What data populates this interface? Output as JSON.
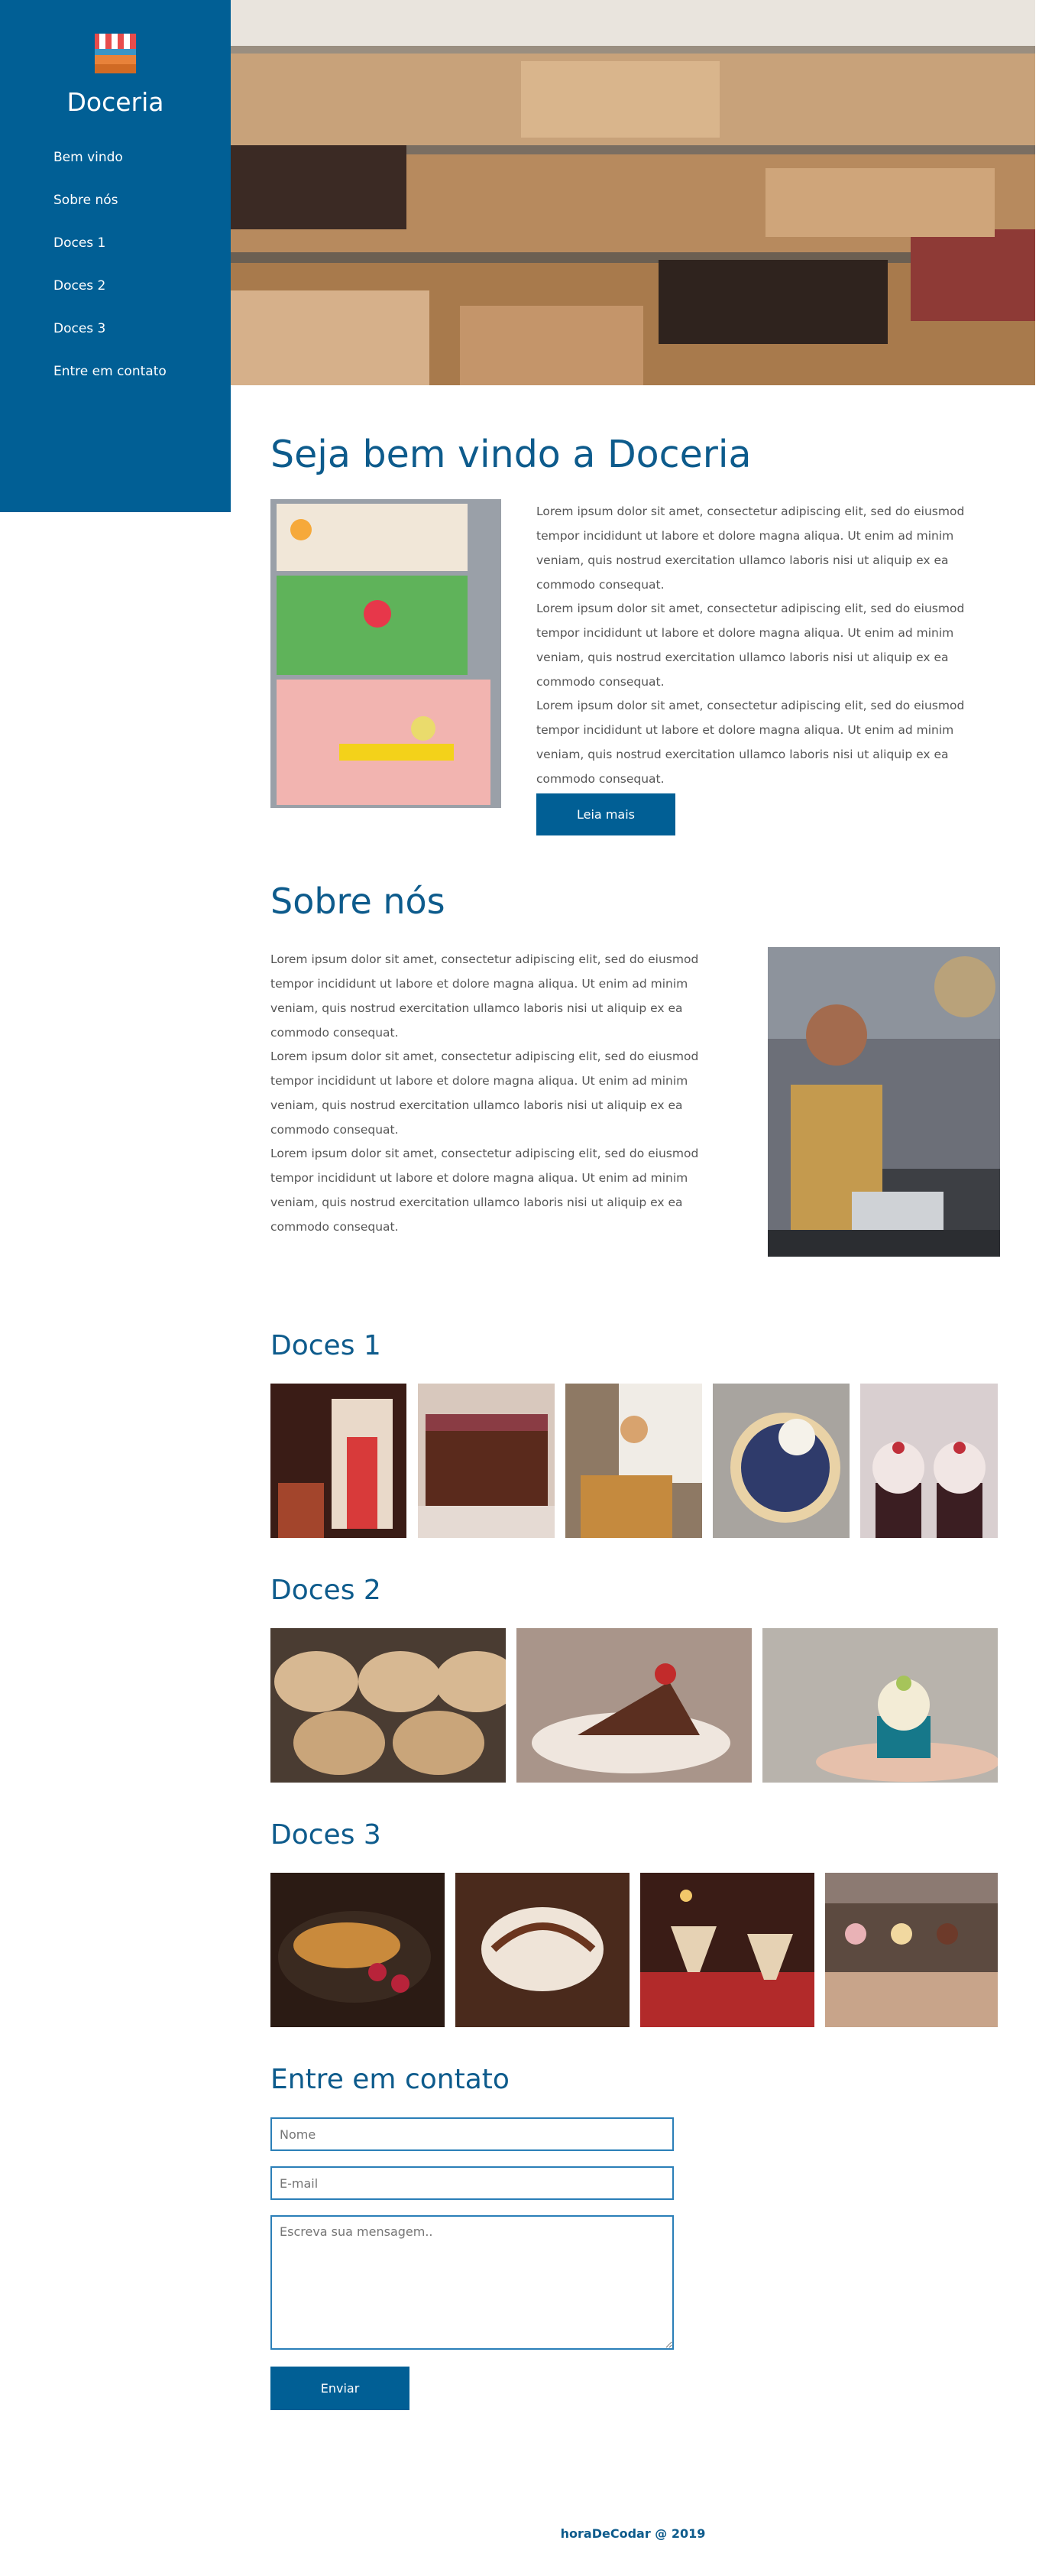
{
  "sidebar": {
    "brand": "Doceria",
    "items": [
      {
        "label": "Bem vindo"
      },
      {
        "label": "Sobre nós"
      },
      {
        "label": "Doces 1"
      },
      {
        "label": "Doces 2"
      },
      {
        "label": "Doces 3"
      },
      {
        "label": "Entre em contato"
      }
    ]
  },
  "welcome": {
    "title": "Seja bem vindo a Doceria",
    "paragraphs": [
      "Lorem ipsum dolor sit amet, consectetur adipiscing elit, sed do eiusmod tempor incididunt ut labore et dolore magna aliqua. Ut enim ad minim veniam, quis nostrud exercitation ullamco laboris nisi ut aliquip ex ea commodo consequat.",
      "Lorem ipsum dolor sit amet, consectetur adipiscing elit, sed do eiusmod tempor incididunt ut labore et dolore magna aliqua. Ut enim ad minim veniam, quis nostrud exercitation ullamco laboris nisi ut aliquip ex ea commodo consequat.",
      "Lorem ipsum dolor sit amet, consectetur adipiscing elit, sed do eiusmod tempor incididunt ut labore et dolore magna aliqua. Ut enim ad minim veniam, quis nostrud exercitation ullamco laboris nisi ut aliquip ex ea commodo consequat."
    ],
    "button": "Leia mais"
  },
  "about": {
    "title": "Sobre nós",
    "paragraphs": [
      "Lorem ipsum dolor sit amet, consectetur adipiscing elit, sed do eiusmod tempor incididunt ut labore et dolore magna aliqua. Ut enim ad minim veniam, quis nostrud exercitation ullamco laboris nisi ut aliquip ex ea commodo consequat.",
      "Lorem ipsum dolor sit amet, consectetur adipiscing elit, sed do eiusmod tempor incididunt ut labore et dolore magna aliqua. Ut enim ad minim veniam, quis nostrud exercitation ullamco laboris nisi ut aliquip ex ea commodo consequat.",
      "Lorem ipsum dolor sit amet, consectetur adipiscing elit, sed do eiusmod tempor incididunt ut labore et dolore magna aliqua. Ut enim ad minim veniam, quis nostrud exercitation ullamco laboris nisi ut aliquip ex ea commodo consequat."
    ]
  },
  "gallery1": {
    "title": "Doces 1"
  },
  "gallery2": {
    "title": "Doces 2"
  },
  "gallery3": {
    "title": "Doces 3"
  },
  "contact": {
    "title": "Entre em contato",
    "name_placeholder": "Nome",
    "email_placeholder": "E-mail",
    "message_placeholder": "Escreva sua mensagem..",
    "button": "Enviar"
  },
  "footer": {
    "text": "horaDeCodar @ 2019"
  },
  "colors": {
    "primary": "#015f95",
    "heading": "#0d5b8c",
    "field_border": "#2b7fb8"
  }
}
